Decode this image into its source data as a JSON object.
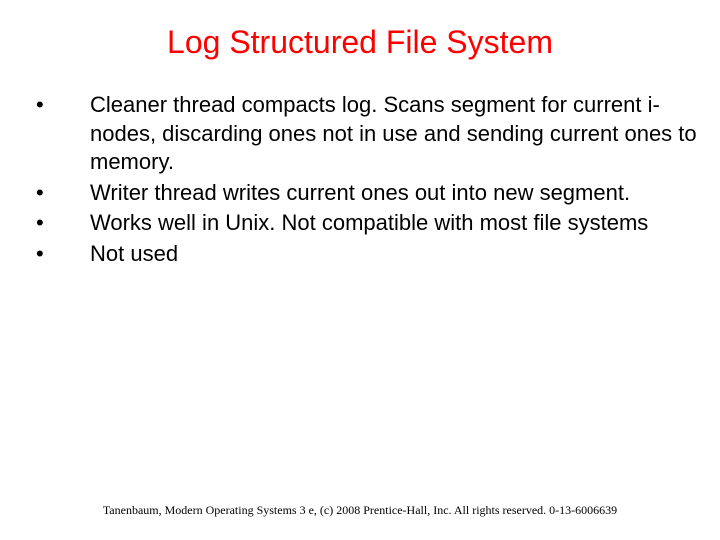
{
  "title": "Log Structured File System",
  "bullets": [
    {
      "text": "Cleaner thread compacts log. Scans segment for current i-nodes, discarding ones not in use and sending current ones to memory."
    },
    {
      "text": "Writer thread writes current ones out into new segment."
    },
    {
      "text": "Works well in Unix. Not compatible with most file systems"
    },
    {
      "text": "Not used"
    }
  ],
  "footer": "Tanenbaum, Modern Operating Systems 3 e, (c) 2008 Prentice-Hall, Inc. All rights reserved. 0-13-6006639"
}
